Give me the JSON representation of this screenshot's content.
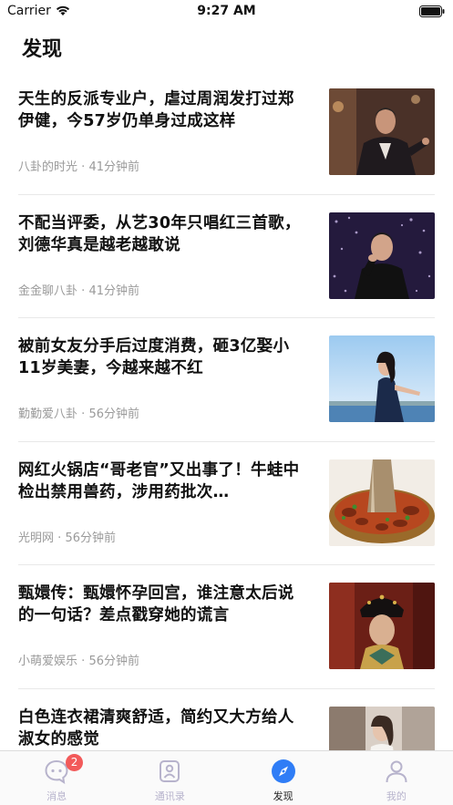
{
  "status_bar": {
    "carrier": "Carrier",
    "time": "9:27 AM"
  },
  "page": {
    "title": "发现"
  },
  "news": [
    {
      "title": "天生的反派专业户，虐过周润发打过郑伊健，今57岁仍单身过成这样",
      "source": "八卦的时光",
      "time": "41分钟前"
    },
    {
      "title": "不配当评委，从艺30年只唱红三首歌，刘德华真是越老越敢说",
      "source": "金金聊八卦",
      "time": "41分钟前"
    },
    {
      "title": "被前女友分手后过度消费，砸3亿娶小11岁美妻，今越来越不红",
      "source": "勤勤爱八卦",
      "time": "56分钟前"
    },
    {
      "title": "网红火锅店“哥老官”又出事了！牛蛙中检出禁用兽药，涉用药批次…",
      "source": "光明网",
      "time": "56分钟前"
    },
    {
      "title": "甄嬛传：甄嬛怀孕回宫，谁注意太后说的一句话？差点戳穿她的谎言",
      "source": "小萌爱娱乐",
      "time": "56分钟前"
    },
    {
      "title": "白色连衣裙清爽舒适，简约又大方给人淑女的感觉",
      "source": "",
      "time": ""
    }
  ],
  "meta_separator": "·",
  "tabs": [
    {
      "label": "消息",
      "icon": "chat-bubble-icon",
      "badge": "2"
    },
    {
      "label": "通讯录",
      "icon": "contacts-icon"
    },
    {
      "label": "发现",
      "icon": "compass-icon"
    },
    {
      "label": "我的",
      "icon": "profile-icon"
    }
  ],
  "colors": {
    "accent": "#2f7df6",
    "inactive": "#b7b3cc",
    "badge": "#f25a5a"
  }
}
